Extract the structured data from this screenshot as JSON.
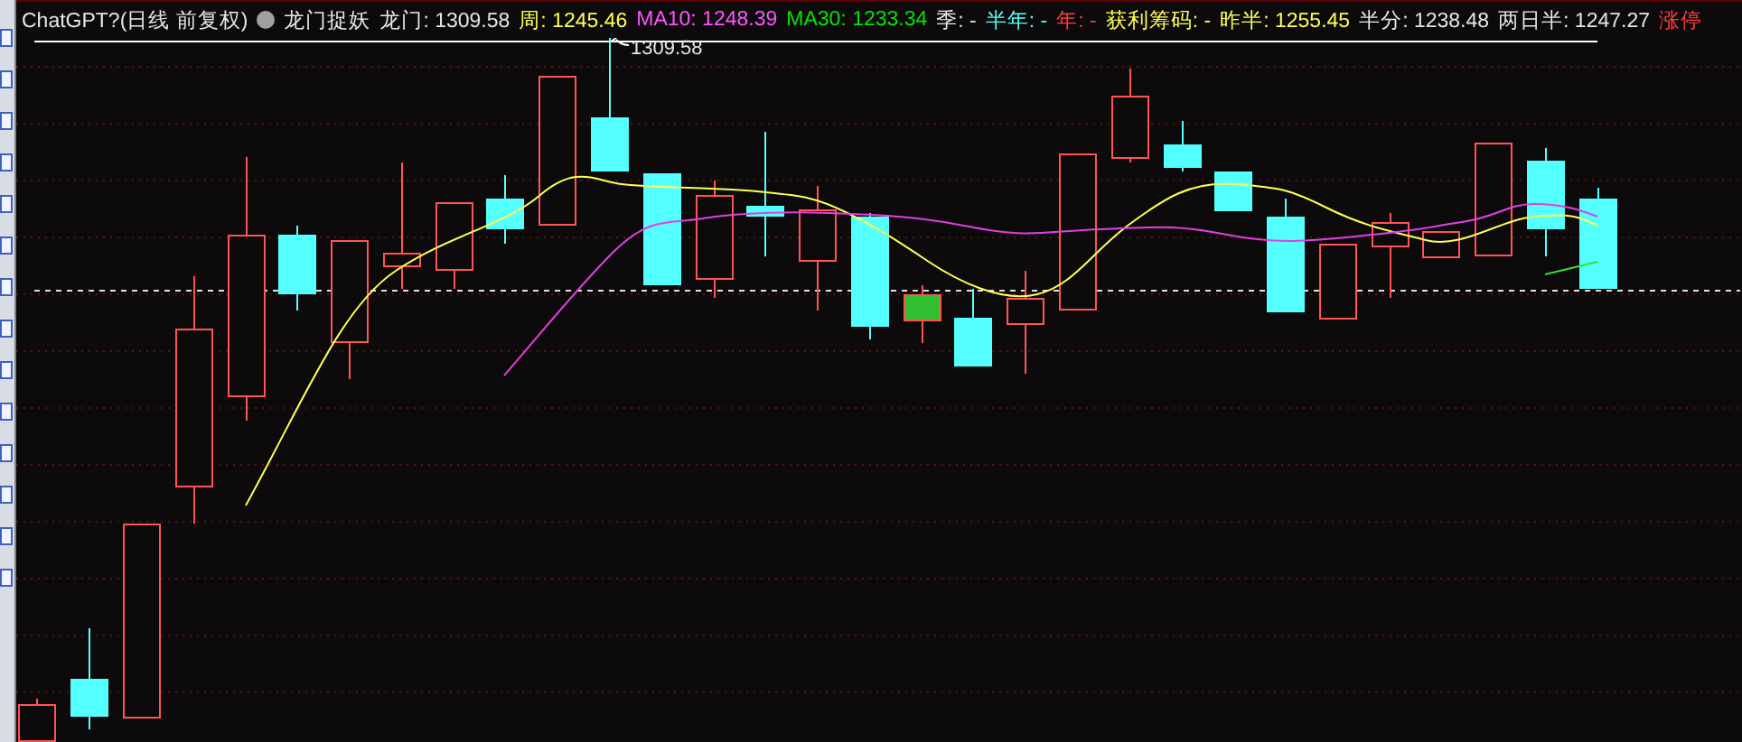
{
  "header": {
    "title": "ChatGPT?(日线 前复权)",
    "indicator": "龙门捉妖",
    "legend": [
      {
        "text": "龙门: 1309.58",
        "color": "#e6e6e6"
      },
      {
        "text": "周: 1245.46",
        "color": "#ffff54"
      },
      {
        "text": "MA10: 1248.39",
        "color": "#ff54ff"
      },
      {
        "text": "MA30: 1233.34",
        "color": "#00e600"
      },
      {
        "text": "季: -",
        "color": "#e6e6e6"
      },
      {
        "text": "半年: -",
        "color": "#54ffff"
      },
      {
        "text": "年: -",
        "color": "#ff3c3c"
      },
      {
        "text": "获利筹码: -",
        "color": "#ffff54"
      },
      {
        "text": "昨半: 1255.45",
        "color": "#ffff54"
      },
      {
        "text": "半分: 1238.48",
        "color": "#e6e6e6"
      },
      {
        "text": "两日半: 1247.27",
        "color": "#e6e6e6"
      },
      {
        "text": "涨停",
        "color": "#ff3c3c"
      }
    ]
  },
  "chart": {
    "high_label": "1309.58"
  }
}
